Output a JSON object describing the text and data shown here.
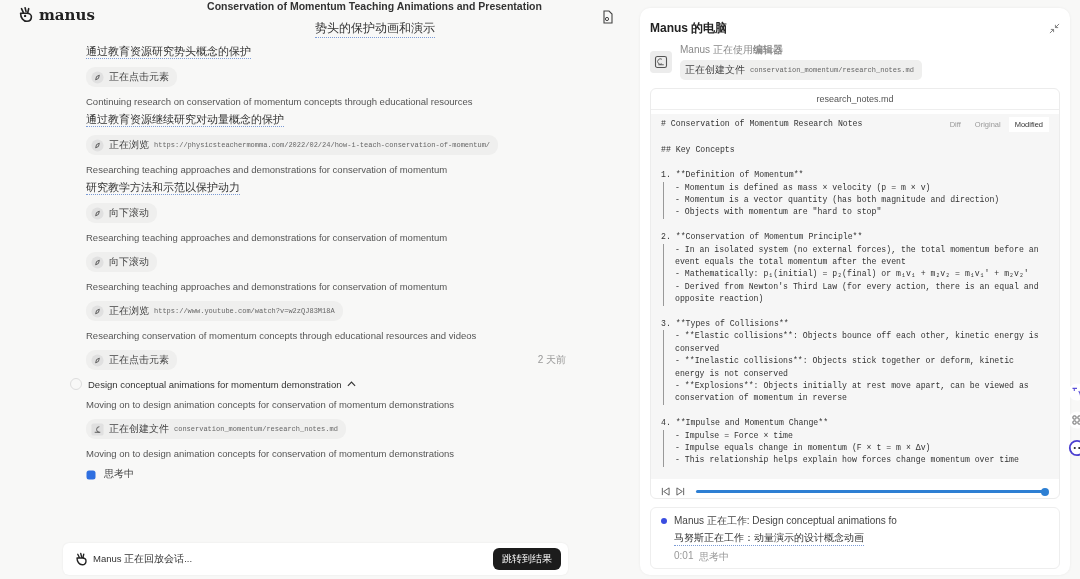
{
  "header": {
    "logo": "manus",
    "title": "Conservation of Momentum Teaching Animations and Presentation",
    "subtitle": "势头的保护动画和演示"
  },
  "feed": [
    {
      "kind": "text",
      "translation": "通过教育资源研究势头概念的保护"
    },
    {
      "kind": "browse_action",
      "label": "正在点击元素"
    },
    {
      "kind": "text",
      "text": "Continuing research on conservation of momentum concepts through educational resources",
      "translation": "通过教育资源继续研究对动量概念的保护"
    },
    {
      "kind": "browse_action",
      "label": "正在浏览",
      "detail": "https://physicsteachermomma.com/2022/02/24/how-i-teach-conservation-of-momentum/"
    },
    {
      "kind": "text",
      "text": "Researching teaching approaches and demonstrations for conservation of momentum",
      "translation": "研究教学方法和示范以保护动力"
    },
    {
      "kind": "browse_action",
      "label": "向下滚动"
    },
    {
      "kind": "text",
      "text": "Researching teaching approaches and demonstrations for conservation of momentum"
    },
    {
      "kind": "browse_action",
      "label": "向下滚动"
    },
    {
      "kind": "text",
      "text": "Researching teaching approaches and demonstrations for conservation of momentum"
    },
    {
      "kind": "browse_action",
      "label": "正在浏览",
      "detail": "https://www.youtube.com/watch?v=w2zQJ83M18A"
    },
    {
      "kind": "text",
      "text": "Researching conservation of momentum concepts through educational resources and videos"
    },
    {
      "kind": "browse_action",
      "label": "正在点击元素",
      "time": "2 天前"
    },
    {
      "kind": "step",
      "title": "Design conceptual animations for momentum demonstration",
      "checked": false,
      "expanded": true
    },
    {
      "kind": "text",
      "text": "Moving on to design animation concepts for conservation of momentum demonstrations"
    },
    {
      "kind": "edit_action",
      "label": "正在创建文件",
      "detail": "conservation_momentum/research_notes.md"
    },
    {
      "kind": "text",
      "text": "Moving on to design animation concepts for conservation of momentum demonstrations"
    },
    {
      "kind": "thinking",
      "label": "思考中"
    }
  ],
  "playback": {
    "text": "Manus 正在回放会话...",
    "button": "跳转到结果"
  },
  "computer": {
    "title": "Manus 的电脑",
    "status": "Manus 正在使用**编辑器**",
    "action": "正在创建文件",
    "path": "conservation_momentum/research_notes.md",
    "editor": {
      "filename": "research_notes.md",
      "first_line": "# Conservation of Momentum Research Notes",
      "tabs": [
        {
          "label": "Diff",
          "selected": false
        },
        {
          "label": "Original",
          "selected": false
        },
        {
          "label": "Modified",
          "selected": true
        }
      ],
      "sections": [
        {
          "kind": "heading",
          "text": "## Key Concepts"
        },
        {
          "kind": "list",
          "heading": "1. **Definition of Momentum**",
          "bullets": [
            "- Momentum is defined as mass × velocity (p = m × v)",
            "- Momentum is a vector quantity (has both magnitude and direction)",
            "- Objects with momentum are \"hard to stop\""
          ]
        },
        {
          "kind": "list",
          "heading": "2. **Conservation of Momentum Principle**",
          "bullets": [
            "- In an isolated system (no external forces), the total momentum before an event equals the total momentum after the event",
            "- Mathematically: p₁(initial) = p₂(final) or m₁v₁ + m₂v₂ = m₁v₁' + m₂v₂'",
            "- Derived from Newton's Third Law (for every action, there is an equal and opposite reaction)"
          ]
        },
        {
          "kind": "list",
          "heading": "3. **Types of Collisions**",
          "bullets": [
            "- **Elastic collisions**: Objects bounce off each other, kinetic energy is conserved",
            "- **Inelastic collisions**: Objects stick together or deform, kinetic energy is not conserved",
            "- **Explosions**: Objects initially at rest move apart, can be viewed as conservation of momentum in reverse"
          ]
        },
        {
          "kind": "list",
          "heading": "4. **Impulse and Momentum Change**",
          "bullets": [
            "- Impulse = Force × time",
            "- Impulse equals change in momentum (F × t = m × Δv)",
            "- This relationship helps explain how forces change momentum over time"
          ]
        }
      ]
    },
    "player": {
      "level": 1
    },
    "activity": {
      "text": "Manus 正在工作: Design conceptual animations fo",
      "translation": "马努斯正在工作：动量演示的设计概念动画",
      "time": "0:01",
      "state": "思考中"
    }
  }
}
